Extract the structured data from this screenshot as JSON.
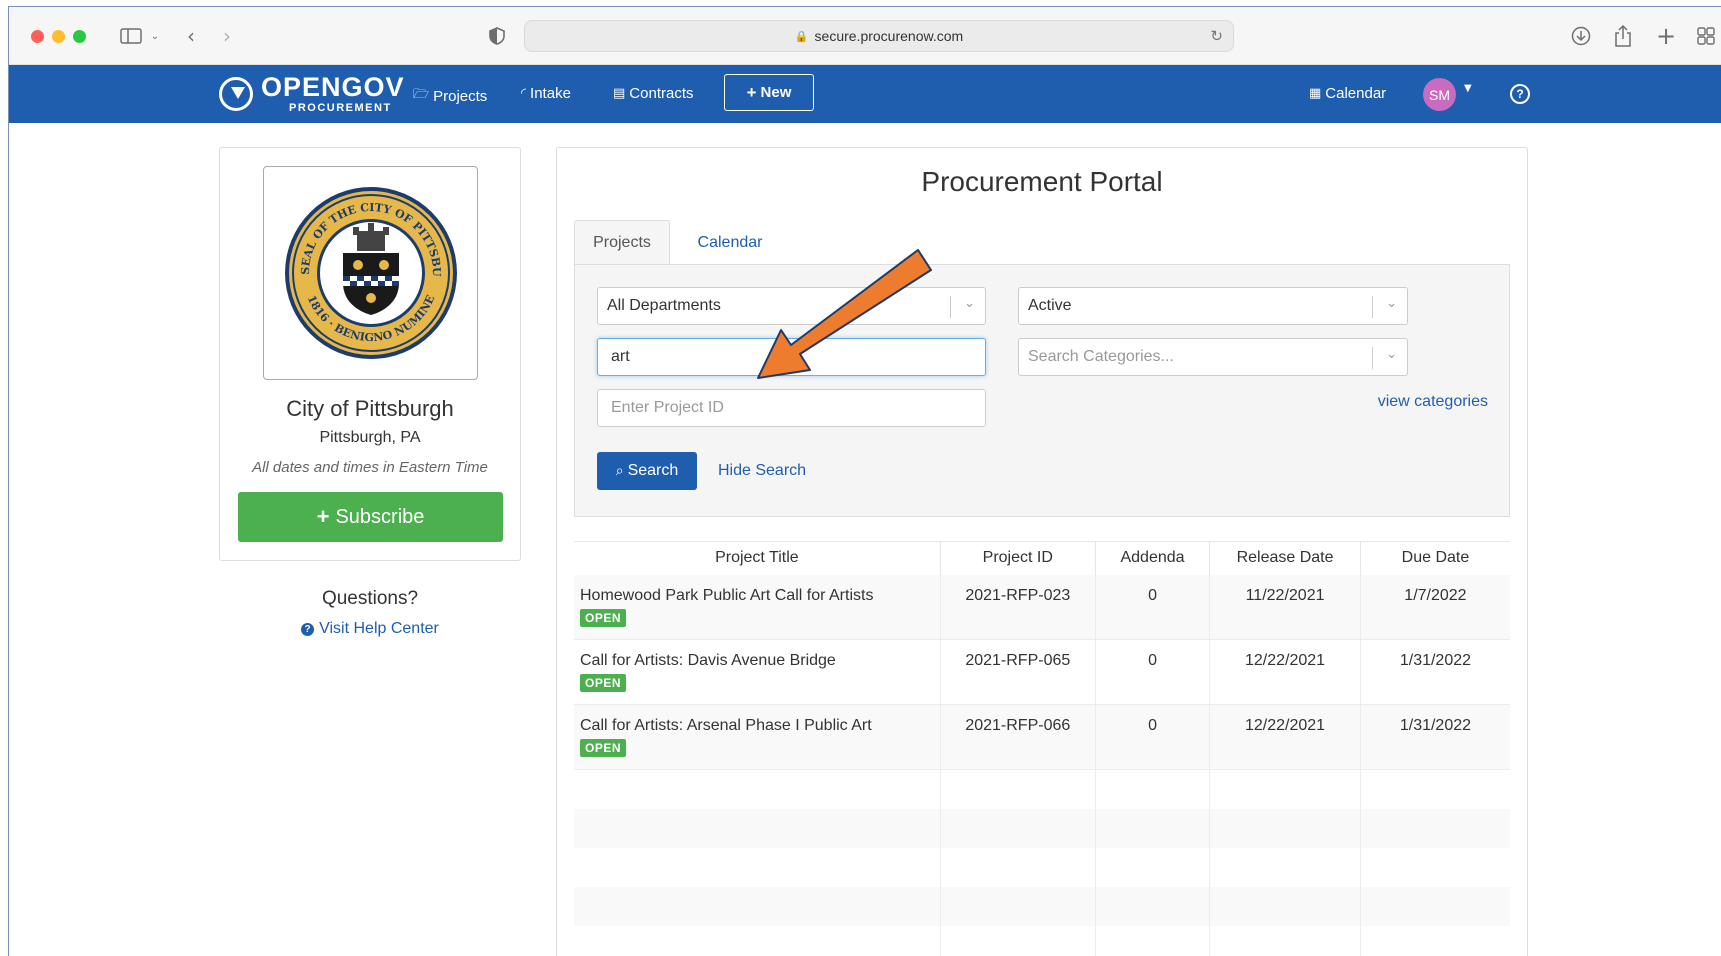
{
  "browser": {
    "url": "secure.procurenow.com"
  },
  "nav": {
    "brand": "OPENGOV",
    "brand_sub": "PROCUREMENT",
    "projects": "Projects",
    "intake": "Intake",
    "contracts": "Contracts",
    "new": "New",
    "calendar": "Calendar",
    "avatar_initials": "SM",
    "help": "?"
  },
  "org": {
    "name": "City of Pittsburgh",
    "location": "Pittsburgh, PA",
    "timezone_note": "All dates and times in Eastern Time",
    "subscribe": "Subscribe",
    "seal_text_top": "THE SEAL OF THE CITY OF PITTSBURGH",
    "seal_text_bottom": "1816 · BENIGNO NUMINE"
  },
  "help": {
    "questions": "Questions?",
    "visit": "Visit Help Center"
  },
  "portal": {
    "title": "Procurement Portal",
    "tabs": [
      "Projects",
      "Calendar"
    ],
    "department": "All Departments",
    "status": "Active",
    "search_value": "art",
    "categories_placeholder": "Search Categories...",
    "project_id_placeholder": "Enter Project ID",
    "view_categories": "view categories",
    "search_button": "Search",
    "hide_search": "Hide Search"
  },
  "table": {
    "columns": [
      "Project Title",
      "Project ID",
      "Addenda",
      "Release Date",
      "Due Date"
    ],
    "rows": [
      {
        "title": "Homewood Park Public Art Call for Artists",
        "status": "OPEN",
        "id": "2021-RFP-023",
        "addenda": "0",
        "release": "11/22/2021",
        "due": "1/7/2022"
      },
      {
        "title": "Call for Artists: Davis Avenue Bridge",
        "status": "OPEN",
        "id": "2021-RFP-065",
        "addenda": "0",
        "release": "12/22/2021",
        "due": "1/31/2022"
      },
      {
        "title": "Call for Artists: Arsenal Phase I Public Art",
        "status": "OPEN",
        "id": "2021-RFP-066",
        "addenda": "0",
        "release": "12/22/2021",
        "due": "1/31/2022"
      }
    ]
  },
  "colors": {
    "nav_blue": "#1f5eae",
    "subscribe_green": "#4cb04f",
    "arrow_orange": "#ee7c2f",
    "avatar": "#c96bc0"
  }
}
